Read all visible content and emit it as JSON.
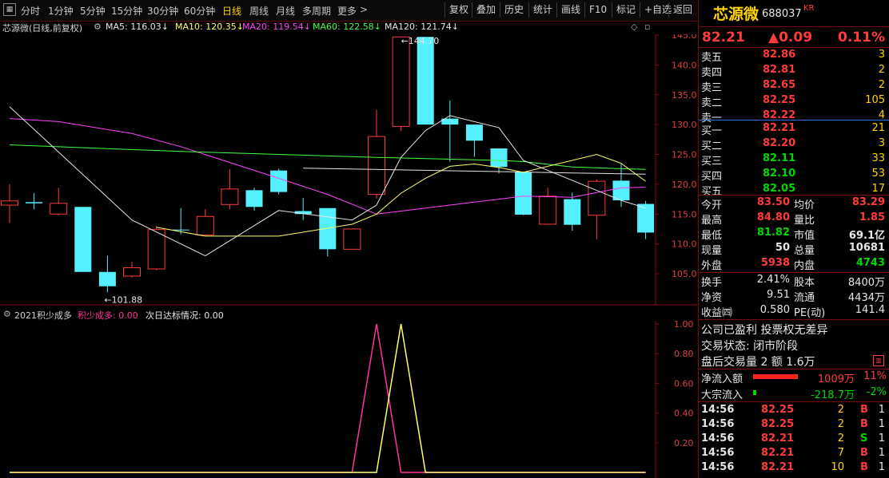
{
  "toolbar": {
    "periods": [
      "分时",
      "1分钟",
      "5分钟",
      "15分钟",
      "30分钟",
      "60分钟",
      "日线",
      "周线",
      "月线",
      "多周期",
      "更多"
    ],
    "active_period": "日线",
    "more_arrow": ">",
    "actions": [
      "复权",
      "叠加",
      "历史",
      "统计",
      "画线",
      "F10",
      "标记",
      "+自选",
      "返回"
    ]
  },
  "kline": {
    "stock_label": "芯源微(日线,前复权)",
    "ma": [
      {
        "label": "MA5: 116.03",
        "arrow": "↓",
        "color": "#e6e6e6"
      },
      {
        "label": "MA10: 120.35",
        "arrow": "↓",
        "color": "#ffff66"
      },
      {
        "label": "MA20: 119.54",
        "arrow": "↓",
        "color": "#ff44ff"
      },
      {
        "label": "MA60: 122.58",
        "arrow": "↓",
        "color": "#44ff44"
      },
      {
        "label": "MA120: 121.74",
        "arrow": "↓",
        "color": "#e6e6e6"
      }
    ],
    "axis_ticks": [
      "145.0",
      "140.0",
      "135.0",
      "130.0",
      "125.0",
      "120.0",
      "115.0",
      "110.0",
      "105.0"
    ],
    "high_mark": "144.70",
    "low_mark": "101.88",
    "colors": {
      "up": "#ff3b3b",
      "down": "#55f0ff",
      "ma5": "#e6e6e6",
      "ma10": "#ffff66",
      "ma20": "#ff44ff",
      "ma60": "#44ff44",
      "ma120": "#e6e6e6"
    },
    "candles": [
      {
        "o": 116.5,
        "c": 117.2,
        "h": 120,
        "l": 113.5
      },
      {
        "o": 117.0,
        "c": 116.8,
        "h": 118.5,
        "l": 115.8
      },
      {
        "o": 115.0,
        "c": 116.8,
        "h": 119.4,
        "l": 114.8
      },
      {
        "o": 116.2,
        "c": 105.3,
        "h": 116.2,
        "l": 105.3
      },
      {
        "o": 105.3,
        "c": 102.9,
        "h": 108.0,
        "l": 101.88
      },
      {
        "o": 104.6,
        "c": 106.0,
        "h": 107.0,
        "l": 104.4
      },
      {
        "o": 105.8,
        "c": 112.4,
        "h": 113.0,
        "l": 105.6
      },
      {
        "o": 112.4,
        "c": 112.3,
        "h": 116.0,
        "l": 111.6
      },
      {
        "o": 111.5,
        "c": 114.6,
        "h": 115.8,
        "l": 111.4
      },
      {
        "o": 116.6,
        "c": 119.2,
        "h": 122.5,
        "l": 115.8
      },
      {
        "o": 119.0,
        "c": 116.2,
        "h": 119.4,
        "l": 115.6
      },
      {
        "o": 122.3,
        "c": 118.7,
        "h": 122.6,
        "l": 118.3
      },
      {
        "o": 115.5,
        "c": 115.0,
        "h": 117.7,
        "l": 114.0
      },
      {
        "o": 116.0,
        "c": 109.1,
        "h": 116.0,
        "l": 107.9
      },
      {
        "o": 109.1,
        "c": 112.5,
        "h": 112.5,
        "l": 109.1
      },
      {
        "o": 118.3,
        "c": 128.0,
        "h": 132.5,
        "l": 117.6
      },
      {
        "o": 129.7,
        "c": 144.7,
        "h": 144.7,
        "l": 128.9
      },
      {
        "o": 144.7,
        "c": 130.0,
        "h": 144.7,
        "l": 130.0
      },
      {
        "o": 131.0,
        "c": 130.0,
        "h": 134.0,
        "l": 123.8
      },
      {
        "o": 130.0,
        "c": 127.3,
        "h": 130.0,
        "l": 124.6
      },
      {
        "o": 126.0,
        "c": 122.9,
        "h": 126.0,
        "l": 121.8
      },
      {
        "o": 122.0,
        "c": 114.9,
        "h": 122.0,
        "l": 114.8
      },
      {
        "o": 113.3,
        "c": 118.0,
        "h": 119.4,
        "l": 113.2
      },
      {
        "o": 117.5,
        "c": 113.2,
        "h": 118.6,
        "l": 112.2
      },
      {
        "o": 114.8,
        "c": 120.5,
        "h": 120.8,
        "l": 110.8
      },
      {
        "o": 120.6,
        "c": 117.3,
        "h": 123.4,
        "l": 116.2
      },
      {
        "o": 116.7,
        "c": 111.9,
        "h": 117.2,
        "l": 110.8
      }
    ],
    "ma5": [
      133.0,
      null,
      null,
      null,
      null,
      114.0,
      null,
      null,
      108.0,
      null,
      null,
      115.6,
      null,
      null,
      114.0,
      116.5,
      124.5,
      129.0,
      131.5,
      null,
      129.5,
      124.0,
      null,
      null,
      null,
      117.3,
      116.0
    ],
    "ma10": [
      null,
      null,
      null,
      null,
      null,
      null,
      112.8,
      null,
      111.3,
      null,
      null,
      111.3,
      null,
      null,
      113.3,
      115.0,
      118.5,
      121.0,
      123.0,
      123.4,
      122.8,
      122.0,
      null,
      null,
      125.0,
      123.5,
      120.5
    ],
    "ma20": [
      131.0,
      null,
      130.5,
      null,
      null,
      128.5,
      null,
      126.3,
      null,
      null,
      null,
      121.0,
      null,
      118.3,
      null,
      115.0,
      115.5,
      116.0,
      116.5,
      117.0,
      117.5,
      118.0,
      null,
      117.8,
      null,
      119.4,
      119.5
    ],
    "ma60": [
      126.6,
      null,
      null,
      null,
      null,
      null,
      null,
      125.5,
      null,
      null,
      null,
      125.0,
      null,
      null,
      null,
      124.5,
      null,
      null,
      124.2,
      null,
      124.0,
      123.8,
      null,
      122.9,
      null,
      122.6,
      122.5
    ],
    "ma120": [
      null,
      null,
      null,
      null,
      null,
      null,
      null,
      null,
      null,
      null,
      null,
      null,
      122.7,
      null,
      null,
      null,
      null,
      null,
      null,
      null,
      null,
      null,
      null,
      121.9,
      null,
      null,
      121.7
    ]
  },
  "indicator": {
    "name": "2021积少成多",
    "line1_label": "积少成多: 0.00",
    "line2_label": "次日达标情况: 0.00",
    "axis_ticks": [
      "1.00",
      "0.80",
      "0.60",
      "0.40",
      "0.20"
    ],
    "line1_color": "#ff3399",
    "line2_color": "#ffff66",
    "line1": [
      0,
      0,
      0,
      0,
      0,
      0,
      0,
      0,
      0,
      0,
      0,
      0,
      0,
      0,
      0,
      1,
      0,
      0,
      0,
      0,
      0,
      0,
      0,
      0,
      0,
      0,
      0
    ],
    "line2": [
      0,
      0,
      0,
      0,
      0,
      0,
      0,
      0,
      0,
      0,
      0,
      0,
      0,
      0,
      0,
      0,
      1,
      0,
      0,
      0,
      0,
      0,
      0,
      0,
      0,
      0,
      0
    ]
  },
  "quote": {
    "name": "芯源微",
    "code": "688037",
    "tag": "KR",
    "price": "82.21",
    "change": "▲0.09",
    "pct": "0.11%",
    "asks": [
      {
        "label": "卖五",
        "price": "82.86",
        "vol": "3"
      },
      {
        "label": "卖四",
        "price": "82.81",
        "vol": "2"
      },
      {
        "label": "卖三",
        "price": "82.65",
        "vol": "2"
      },
      {
        "label": "卖二",
        "price": "82.25",
        "vol": "105"
      },
      {
        "label": "卖一",
        "price": "82.22",
        "vol": "4"
      }
    ],
    "bids": [
      {
        "label": "买一",
        "price": "82.21",
        "vol": "21",
        "color": "red"
      },
      {
        "label": "买二",
        "price": "82.20",
        "vol": "3",
        "color": "red"
      },
      {
        "label": "买三",
        "price": "82.11",
        "vol": "33",
        "color": "green"
      },
      {
        "label": "买四",
        "price": "82.10",
        "vol": "53",
        "color": "green"
      },
      {
        "label": "买五",
        "price": "82.05",
        "vol": "17",
        "color": "green"
      }
    ],
    "stats": [
      {
        "k1": "今开",
        "v1": "83.50",
        "c1": "red",
        "k2": "均价",
        "v2": "83.29",
        "c2": "red"
      },
      {
        "k1": "最高",
        "v1": "84.80",
        "c1": "red",
        "k2": "量比",
        "v2": "1.85",
        "c2": "red"
      },
      {
        "k1": "最低",
        "v1": "81.82",
        "c1": "green",
        "k2": "市值",
        "v2": "69.1亿",
        "c2": "white"
      },
      {
        "k1": "现量",
        "v1": "50",
        "c1": "white",
        "k2": "总量",
        "v2": "10681",
        "c2": "white"
      },
      {
        "k1": "外盘",
        "v1": "5938",
        "c1": "red",
        "k2": "内盘",
        "v2": "4743",
        "c2": "green"
      }
    ],
    "fund": [
      {
        "k1": "换手",
        "v1": "2.41%",
        "k2": "股本",
        "v2": "8400万"
      },
      {
        "k1": "净资",
        "v1": "9.51",
        "k2": "流通",
        "v2": "4434万"
      },
      {
        "k1": "收益㈣",
        "v1": "0.580",
        "k2": "PE(动)",
        "v2": "141.4"
      }
    ],
    "info": [
      "公司已盈利 投票权无差异",
      "交易状态: 闭市阶段",
      "盘后交易量 2 额 1.6万"
    ],
    "flow": [
      {
        "label": "净流入额",
        "value": "1009万",
        "pct": "11%",
        "color": "red",
        "fill": 1.0
      },
      {
        "label": "大宗流入",
        "value": "-218.7万",
        "pct": "-2%",
        "color": "green",
        "fill": 0.08
      }
    ],
    "ticks": [
      {
        "time": "14:56",
        "price": "82.25",
        "vol": "2",
        "side": "B",
        "n": "1"
      },
      {
        "time": "14:56",
        "price": "82.25",
        "vol": "2",
        "side": "B",
        "n": "1"
      },
      {
        "time": "14:56",
        "price": "82.21",
        "vol": "2",
        "side": "S",
        "n": "1"
      },
      {
        "time": "14:56",
        "price": "82.21",
        "vol": "7",
        "side": "B",
        "n": "1"
      },
      {
        "time": "14:56",
        "price": "82.21",
        "vol": "10",
        "side": "B",
        "n": "1"
      }
    ]
  }
}
